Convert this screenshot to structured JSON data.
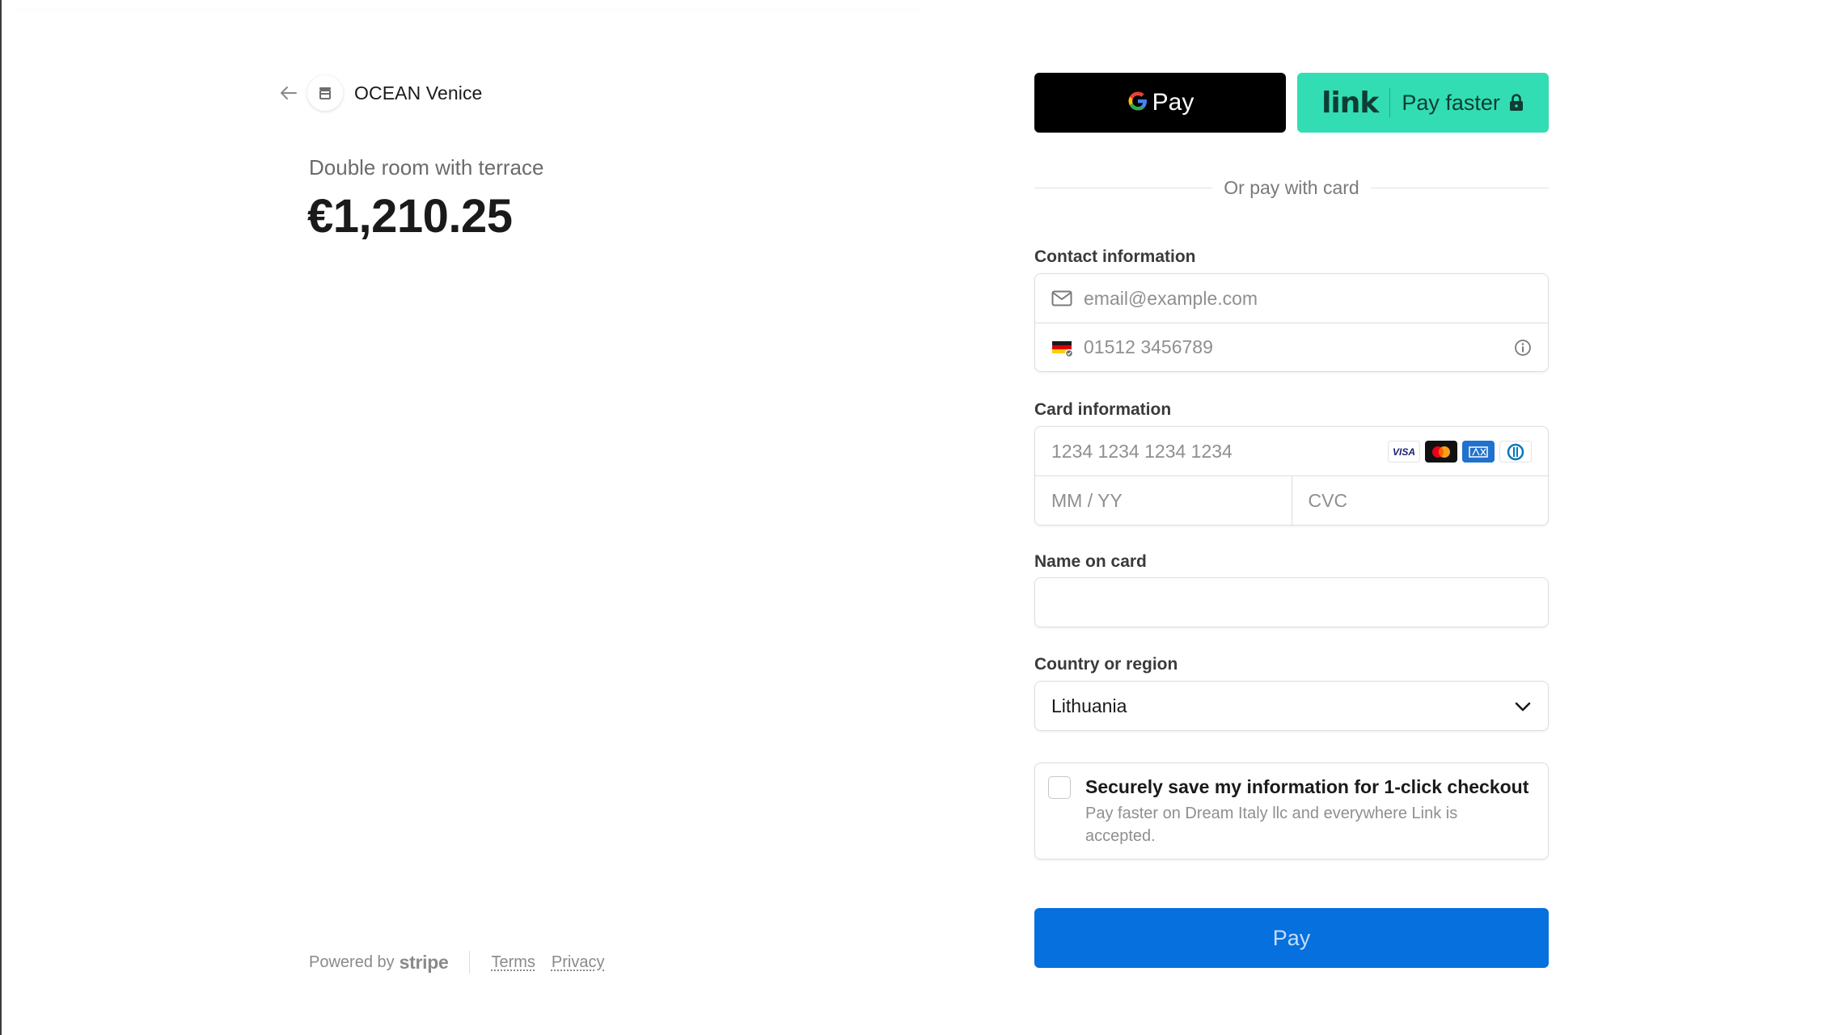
{
  "merchant": {
    "name": "OCEAN Venice",
    "back_icon": "arrow-left-icon",
    "store_icon": "storefront-icon"
  },
  "product": {
    "name": "Double room with terrace",
    "price": "€1,210.25"
  },
  "footer": {
    "powered_by": "Powered by",
    "brand": "stripe",
    "terms": "Terms",
    "privacy": "Privacy"
  },
  "wallets": {
    "gpay_label": "Pay",
    "link_logo": "link",
    "link_label": "Pay faster",
    "gpay_color": "#000000",
    "link_color": "#33ddb3"
  },
  "divider_text": "Or pay with card",
  "contact": {
    "label": "Contact information",
    "email_placeholder": "email@example.com",
    "phone_placeholder": "01512 3456789"
  },
  "card": {
    "label": "Card information",
    "number_placeholder": "1234 1234 1234 1234",
    "expiry_placeholder": "MM / YY",
    "cvc_placeholder": "CVC",
    "brands": [
      "visa-icon",
      "mastercard-icon",
      "amex-icon",
      "diners-icon"
    ],
    "visa_text": "VISA"
  },
  "name_on_card": {
    "label": "Name on card",
    "value": ""
  },
  "country": {
    "label": "Country or region",
    "selected": "Lithuania"
  },
  "save_info": {
    "title": "Securely save my information for 1-click checkout",
    "description": "Pay faster on Dream Italy llc and everywhere Link is accepted.",
    "checked": false
  },
  "pay_button": {
    "label": "Pay",
    "color": "#0570de"
  }
}
